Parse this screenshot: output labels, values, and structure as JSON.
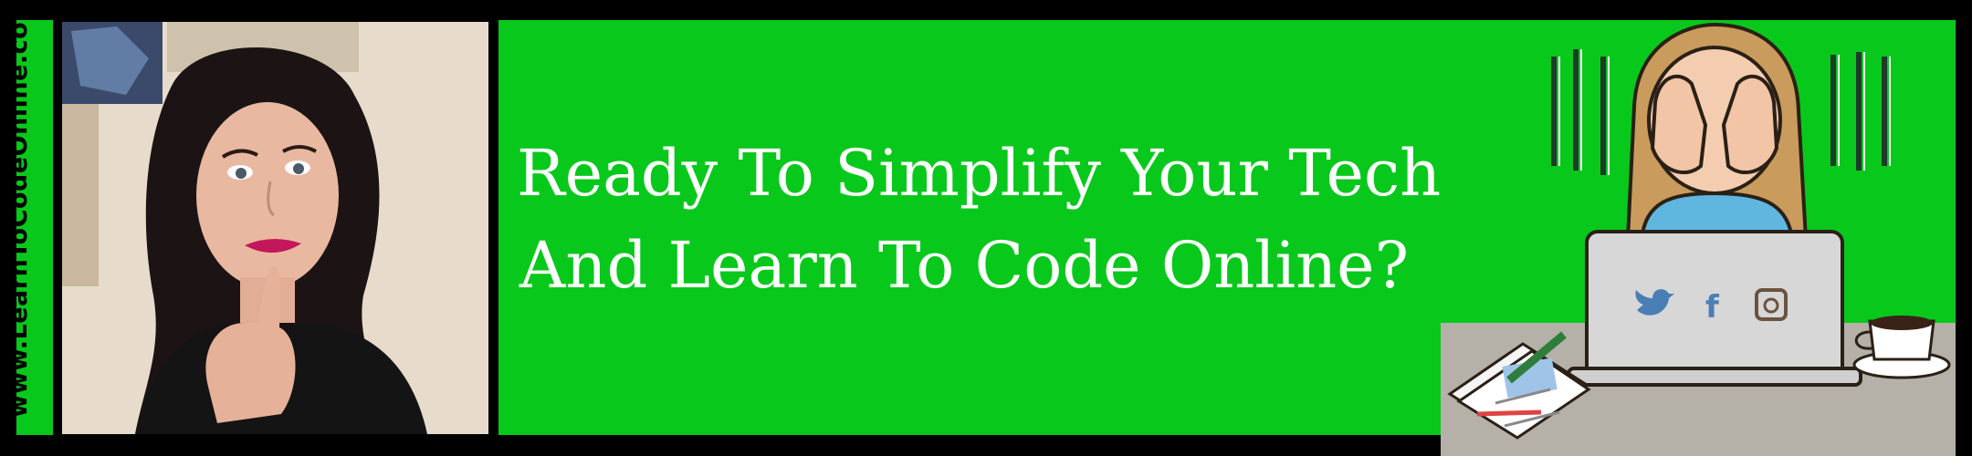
{
  "banner": {
    "side_url": "www.LearnToCodeOnline.com",
    "headline": {
      "line1": "Ready To Simplify Your Tech",
      "line2": "And Learn To Code Online?"
    }
  },
  "colors": {
    "background": "#000000",
    "accent_green": "#08c81c",
    "headline_text": "#ffffff"
  },
  "illustration": {
    "icons": [
      "twitter-icon",
      "facebook-icon",
      "instagram-icon"
    ]
  }
}
